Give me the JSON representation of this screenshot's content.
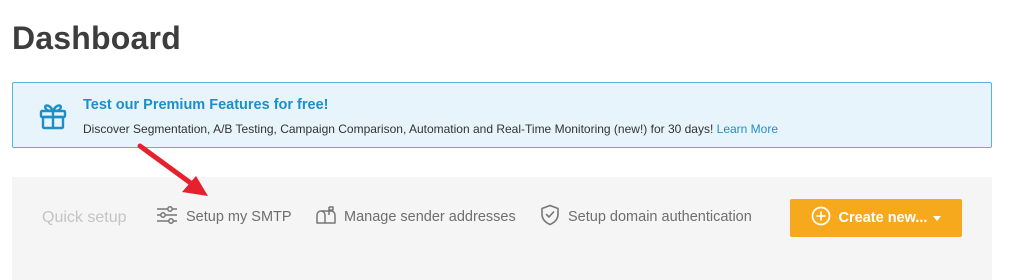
{
  "page": {
    "title": "Dashboard"
  },
  "promo": {
    "headline": "Test our Premium Features for free!",
    "description": "Discover Segmentation, A/B Testing, Campaign Comparison, Automation and Real-Time Monitoring (new!) for 30 days!",
    "learn_more": "Learn More",
    "icon": "gift-icon"
  },
  "quick_setup": {
    "label": "Quick setup",
    "items": [
      {
        "label": "Setup my SMTP",
        "icon": "sliders-icon"
      },
      {
        "label": "Manage sender addresses",
        "icon": "mailbox-icon"
      },
      {
        "label": "Setup domain authentication",
        "icon": "shield-check-icon"
      }
    ],
    "create_button": {
      "label": "Create new...",
      "icon": "plus-circle-icon"
    }
  },
  "colors": {
    "accent_blue": "#1e8fc6",
    "promo_bg": "#e8f4fb",
    "create_orange": "#f7a91d",
    "annotation_arrow": "#e5212e"
  }
}
